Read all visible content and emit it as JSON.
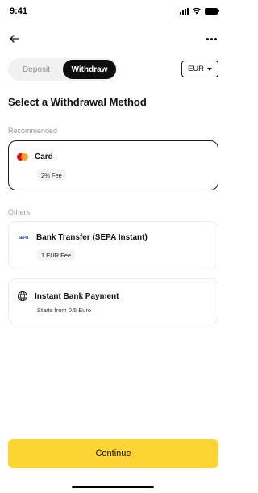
{
  "status_bar": {
    "time": "9:41",
    "icons": [
      "signal-icon",
      "wifi-icon",
      "battery-icon"
    ]
  },
  "nav": {
    "back_icon": "arrow-left-icon",
    "more_icon": "more-horizontal-icon"
  },
  "tabs": [
    {
      "label": "Deposit",
      "active": false
    },
    {
      "label": "Withdraw",
      "active": true
    }
  ],
  "currency": {
    "value": "EUR",
    "icon": "caret-down-icon"
  },
  "title": "Select a Withdrawal Method",
  "sections": {
    "recommended": "Recommended",
    "others": "Others"
  },
  "methods": [
    {
      "name": "Card",
      "detail": "2% Fee",
      "icon": "mastercard-icon",
      "selected": true
    },
    {
      "name": "Bank Transfer (SEPA Instant)",
      "detail": "1 EUR Fee",
      "icon": "sepa-icon",
      "icon_text": "SEPA",
      "selected": false
    },
    {
      "name": "Instant Bank Payment",
      "detail": "Starts from 0.5 Euro",
      "icon": "bank-globe-icon",
      "selected": false
    }
  ],
  "continue_label": "Continue",
  "colors": {
    "accent": "#fcd535",
    "active_tab": "#0d0d0d",
    "mastercard_red": "#eb001b",
    "mastercard_orange": "#f79e1b"
  }
}
